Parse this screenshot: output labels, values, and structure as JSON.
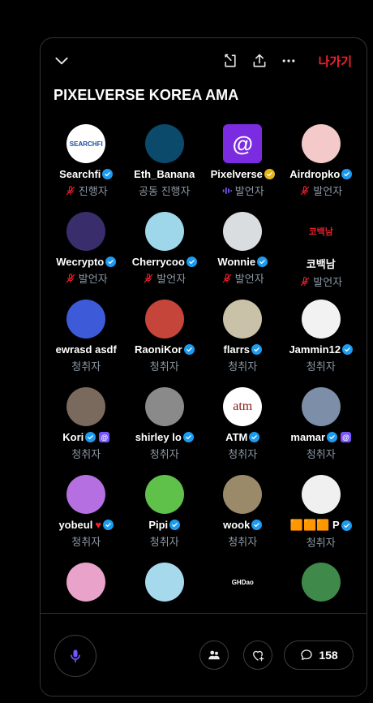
{
  "header": {
    "leave_label": "나가기",
    "icons": [
      "chevron-down-icon",
      "dock-icon",
      "share-icon",
      "more-icon"
    ]
  },
  "space": {
    "title": "PIXELVERSE KOREA AMA"
  },
  "participants": [
    {
      "name": "Searchfi",
      "badge": "blue",
      "role": "진행자",
      "role_icon": "mic-off",
      "avatar_text": "SEARCHFI",
      "avatar_bg": "#ffffff",
      "avatar_fg": "#1b4ea3"
    },
    {
      "name": "Eth_Banana",
      "badge": "none",
      "role": "공동 진행자",
      "role_icon": "none",
      "avatar_text": "",
      "avatar_bg": "#0b4a6b",
      "avatar_fg": "#6fe4ff"
    },
    {
      "name": "Pixelverse",
      "badge": "gold",
      "role": "발언자",
      "role_icon": "speaking",
      "avatar_text": "@",
      "avatar_bg": "#7b2be0",
      "avatar_fg": "#ffffff"
    },
    {
      "name": "Airdropko",
      "badge": "blue",
      "role": "발언자",
      "role_icon": "mic-off",
      "avatar_text": "",
      "avatar_bg": "#f3c9c9",
      "avatar_fg": "#333333"
    },
    {
      "name": "Wecrypto",
      "badge": "blue",
      "role": "발언자",
      "role_icon": "mic-off",
      "avatar_text": "",
      "avatar_bg": "#3a2d6b",
      "avatar_fg": "#ffffff"
    },
    {
      "name": "Cherrycoo",
      "badge": "blue",
      "role": "발언자",
      "role_icon": "mic-off",
      "avatar_text": "",
      "avatar_bg": "#9ed7ea",
      "avatar_fg": "#ffffff"
    },
    {
      "name": "Wonnie",
      "badge": "blue",
      "role": "발언자",
      "role_icon": "mic-off",
      "avatar_text": "",
      "avatar_bg": "#d9dde0",
      "avatar_fg": "#222222"
    },
    {
      "name": "코백남",
      "badge": "none",
      "role": "발언자",
      "role_icon": "mic-off",
      "avatar_text": "코백남",
      "avatar_bg": "#000000",
      "avatar_fg": "#e0202a"
    },
    {
      "name": "ewrasd asdf",
      "badge": "none",
      "role": "청취자",
      "role_icon": "none",
      "avatar_text": "",
      "avatar_bg": "#3d5bd9",
      "avatar_fg": "#ffffff"
    },
    {
      "name": "RaoniKor",
      "badge": "blue",
      "role": "청취자",
      "role_icon": "none",
      "avatar_text": "",
      "avatar_bg": "#c5453a",
      "avatar_fg": "#ffffff"
    },
    {
      "name": "flarrs",
      "badge": "blue",
      "role": "청취자",
      "role_icon": "none",
      "avatar_text": "",
      "avatar_bg": "#c9c2a8",
      "avatar_fg": "#222222"
    },
    {
      "name": "Jammin12",
      "badge": "blue",
      "role": "청취자",
      "role_icon": "none",
      "avatar_text": "",
      "avatar_bg": "#f2f2f2",
      "avatar_fg": "#5a2a1e"
    },
    {
      "name": "Kori",
      "badge": "blue",
      "extra": "spaces",
      "role": "청취자",
      "role_icon": "none",
      "avatar_text": "",
      "avatar_bg": "#7a6a5e",
      "avatar_fg": "#ffffff"
    },
    {
      "name": "shirley lo",
      "badge": "blue",
      "role": "청취자",
      "role_icon": "none",
      "avatar_text": "",
      "avatar_bg": "#8a8a8a",
      "avatar_fg": "#ffffff"
    },
    {
      "name": "ATM",
      "badge": "blue",
      "role": "청취자",
      "role_icon": "none",
      "avatar_text": "atm",
      "avatar_bg": "#ffffff",
      "avatar_fg": "#8a1a1a"
    },
    {
      "name": "mamar",
      "badge": "blue",
      "extra": "spaces",
      "role": "청취자",
      "role_icon": "none",
      "avatar_text": "",
      "avatar_bg": "#7d8fa8",
      "avatar_fg": "#ffffff"
    },
    {
      "name": "yobeul",
      "badge": "blue",
      "extra": "heart",
      "role": "청취자",
      "role_icon": "none",
      "avatar_text": "",
      "avatar_bg": "#b56fe0",
      "avatar_fg": "#ffffff"
    },
    {
      "name": "Pipi",
      "badge": "blue",
      "role": "청취자",
      "role_icon": "none",
      "avatar_text": "",
      "avatar_bg": "#5fc14a",
      "avatar_fg": "#ffffff"
    },
    {
      "name": "wook",
      "badge": "blue",
      "role": "청취자",
      "role_icon": "none",
      "avatar_text": "",
      "avatar_bg": "#9a8a6a",
      "avatar_fg": "#ffffff"
    },
    {
      "name": "🟧🟧🟧 P",
      "badge": "blue",
      "role": "청취자",
      "role_icon": "none",
      "avatar_text": "",
      "avatar_bg": "#f0f0f0",
      "avatar_fg": "#111111"
    },
    {
      "name": "",
      "badge": "none",
      "role": "",
      "role_icon": "none",
      "avatar_text": "",
      "avatar_bg": "#e9a2c9",
      "avatar_fg": "#2a6ad3"
    },
    {
      "name": "",
      "badge": "none",
      "role": "",
      "role_icon": "none",
      "avatar_text": "",
      "avatar_bg": "#a7d9ec",
      "avatar_fg": "#ffffff"
    },
    {
      "name": "",
      "badge": "none",
      "role": "",
      "role_icon": "none",
      "avatar_text": "GHDao",
      "avatar_bg": "#000000",
      "avatar_fg": "#ffffff"
    },
    {
      "name": "",
      "badge": "none",
      "role": "",
      "role_icon": "none",
      "avatar_text": "",
      "avatar_bg": "#3f8a4a",
      "avatar_fg": "#ffffff"
    }
  ],
  "footer": {
    "comments_count": "158",
    "icons": [
      "mic-icon",
      "people-icon",
      "heart-plus-icon",
      "comment-icon"
    ]
  },
  "colors": {
    "accent_blue": "#1d9bf0",
    "verified_gold": "#e2b719",
    "danger": "#f4212e",
    "spaces_purple": "#7856ff",
    "muted_text": "#8b98a5"
  }
}
